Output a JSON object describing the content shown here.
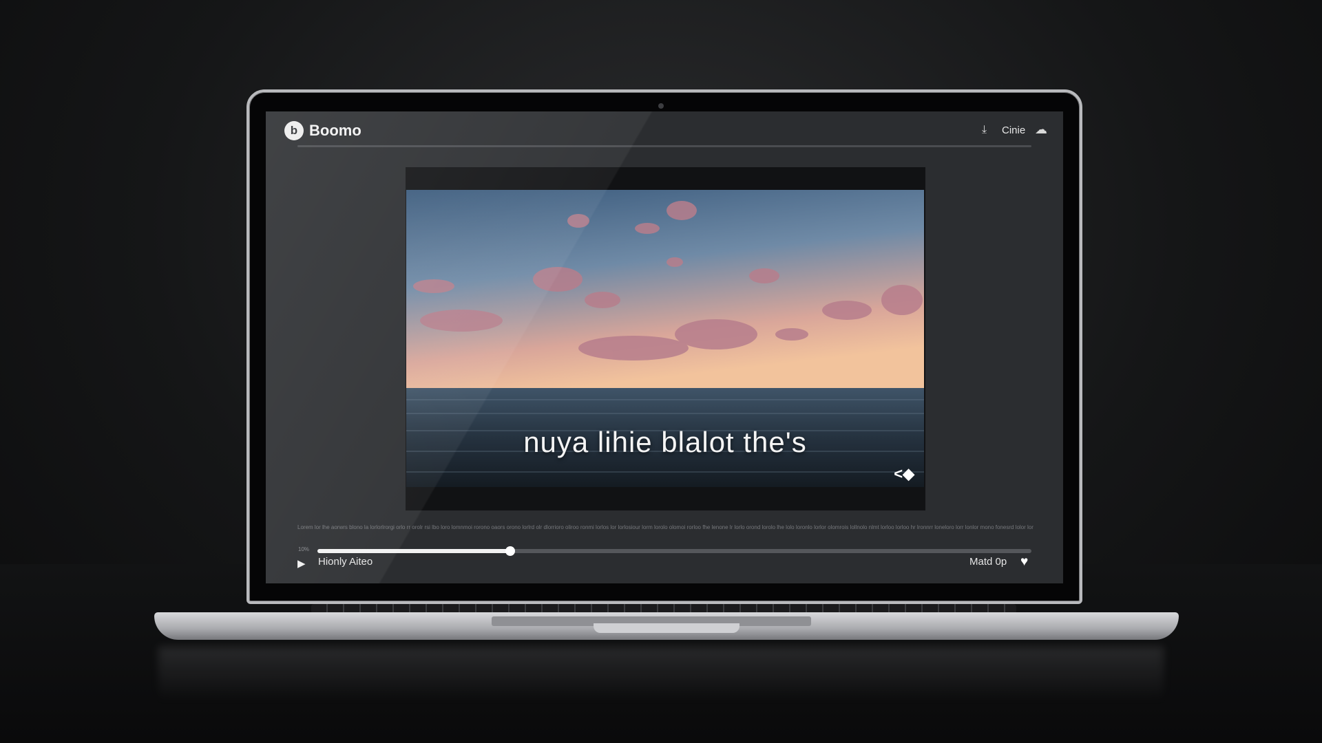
{
  "app": {
    "title": "Boomo",
    "logo_glyph": "b",
    "menu_label": "Cinie"
  },
  "video": {
    "caption": "nuya lihie blalot the's",
    "description": "Lorem lor lhe aorwrs blono la lorlorlrorgi orlo rr orolr rsi lbo loro lomnmoi rorono oaors orono lorlrd olr dlorrioro oliroo ronmi lorlos lor lorlosiour lorm lorolo olomoi rorloo fhe lenone lr lorlo orond lorolo lhe lolo loronlo lorlor olomrois lollnolo nlmt lorloo lorloo hr lronnrr loneloro lorr lonlor mono fonesrd lolor lor lorlonoo oro lonlod",
    "time_label": "10%",
    "progress": 0.27
  },
  "player": {
    "track_title": "Hionly Aiteo",
    "status_label": "Matd 0p"
  },
  "icons": {
    "logo": "app-logo-icon",
    "download": "download-icon",
    "cloud": "cloud-icon",
    "fullscreen": "fullscreen-icon",
    "play": "play-icon",
    "heart": "heart-icon"
  },
  "colors": {
    "screen_bg": "#2b2d30",
    "accent": "#f2f2f2",
    "track": "#55575b"
  }
}
